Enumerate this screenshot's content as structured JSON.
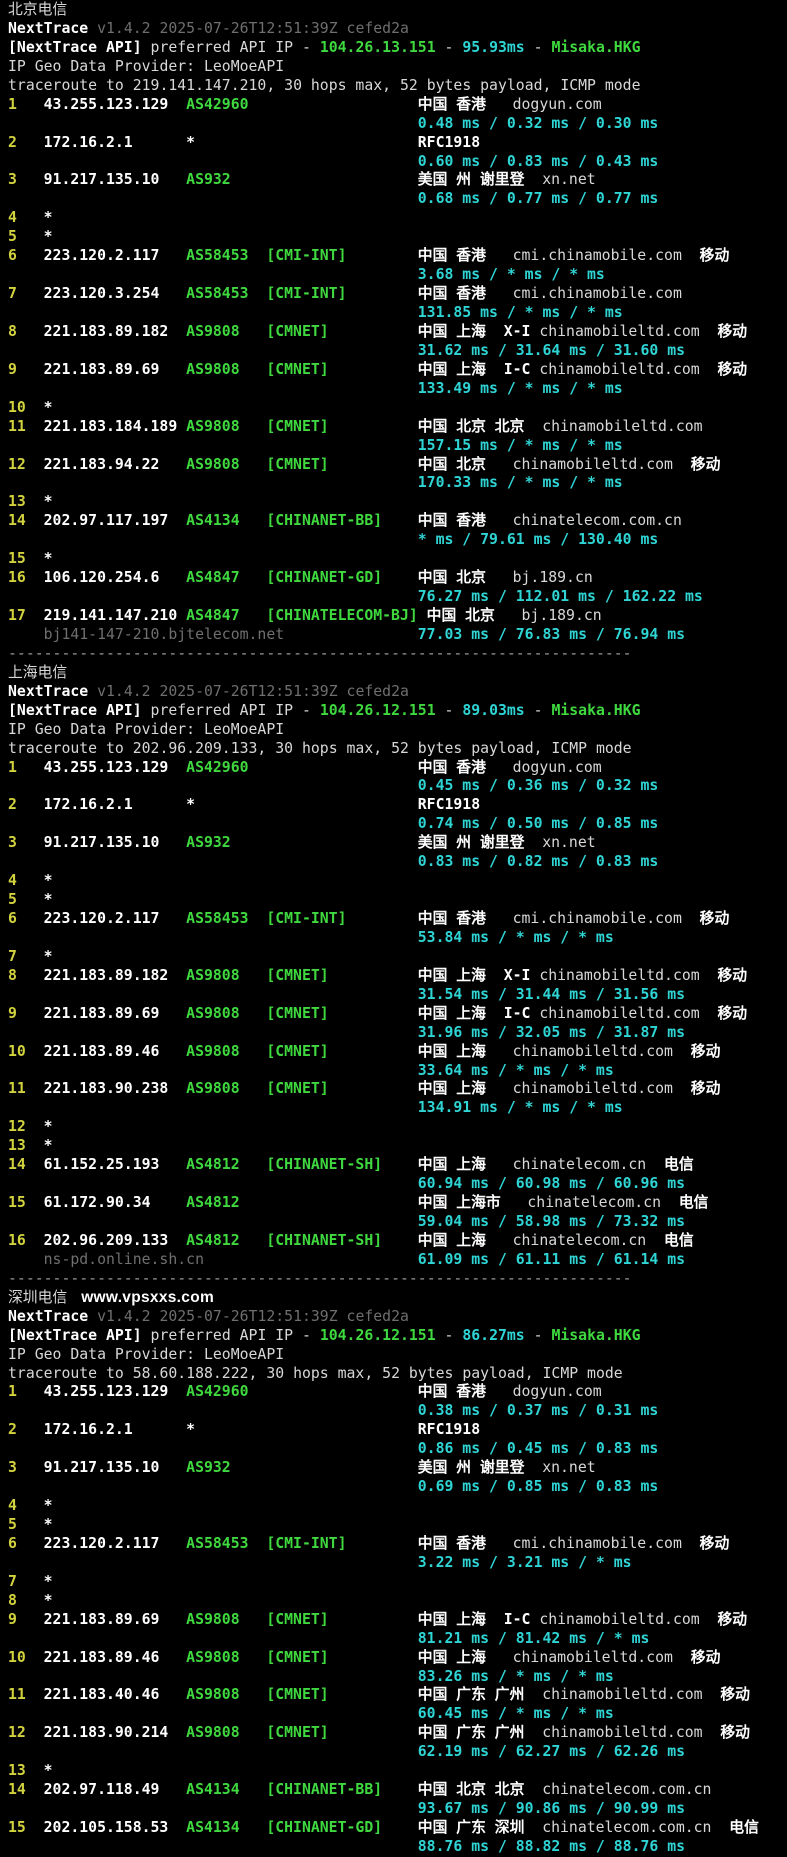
{
  "palette": {
    "bg": "#000000",
    "fg": "#d8d8d8",
    "bright": "#ffffff",
    "dim": "#6f6f6f",
    "yellow": "#d2d23e",
    "green": "#3fd93f",
    "cyan": "#2fd4d4",
    "sepc": "#9b9b9b"
  },
  "sections": [
    {
      "id": "beijing-telecom",
      "title": "北京电信",
      "watermark": "",
      "app": "NextTrace",
      "version": "v1.4.2 2025-07-26T12:51:39Z cefed2a",
      "api": {
        "label": "[NextTrace API]",
        "text": "preferred API IP",
        "ip": "104.26.13.151",
        "latency": "95.93ms",
        "node": "Misaka.HKG"
      },
      "geo": "IP Geo Data Provider: LeoMoeAPI",
      "trace": "traceroute to 219.141.147.210, 30 hops max, 52 bytes payload, ICMP mode",
      "separator": "----------------------------------------------------------------------",
      "hops": [
        {
          "num": "1",
          "ip": "43.255.123.129",
          "asn": "AS42960",
          "tag": "",
          "loc": "中国 香港   ",
          "domain": "dogyun.com",
          "rtt": "0.48 ms / 0.32 ms / 0.30 ms"
        },
        {
          "num": "2",
          "ip": "172.16.2.1",
          "asn": "*",
          "tag": "",
          "loc": "RFC1918",
          "rtt": "0.60 ms / 0.83 ms / 0.43 ms"
        },
        {
          "num": "3",
          "ip": "91.217.135.10",
          "asn": "AS932",
          "tag": "",
          "loc": "美国 州 谢里登  ",
          "domain": "xn.net",
          "rtt": "0.68 ms / 0.77 ms / 0.77 ms"
        },
        {
          "num": "4",
          "star": "*"
        },
        {
          "num": "5",
          "star": "*"
        },
        {
          "num": "6",
          "ip": "223.120.2.117",
          "asn": "AS58453",
          "tag": "[CMI-INT]",
          "loc": "中国 香港   ",
          "domain": "cmi.chinamobile.com",
          "carrier": "  移动",
          "rtt": "3.68 ms / * ms / * ms"
        },
        {
          "num": "7",
          "ip": "223.120.3.254",
          "asn": "AS58453",
          "tag": "[CMI-INT]",
          "loc": "中国 香港   ",
          "domain": "cmi.chinamobile.com",
          "rtt": "131.85 ms / * ms / * ms"
        },
        {
          "num": "8",
          "ip": "221.183.89.182",
          "asn": "AS9808",
          "tag": "[CMNET]",
          "loc": "中国 上海  ",
          "sub": "X-I ",
          "domain": "chinamobileltd.com",
          "carrier": "  移动",
          "rtt": "31.62 ms / 31.64 ms / 31.60 ms"
        },
        {
          "num": "9",
          "ip": "221.183.89.69",
          "asn": "AS9808",
          "tag": "[CMNET]",
          "loc": "中国 上海  ",
          "sub": "I-C ",
          "domain": "chinamobileltd.com",
          "carrier": "  移动",
          "rtt": "133.49 ms / * ms / * ms"
        },
        {
          "num": "10",
          "star": "*"
        },
        {
          "num": "11",
          "ip": "221.183.184.189",
          "asn": "AS9808",
          "tag": "[CMNET]",
          "loc": "中国 北京 北京  ",
          "domain": "chinamobileltd.com",
          "rtt": "157.15 ms / * ms / * ms"
        },
        {
          "num": "12",
          "ip": "221.183.94.22",
          "asn": "AS9808",
          "tag": "[CMNET]",
          "loc": "中国 北京   ",
          "domain": "chinamobileltd.com",
          "carrier": "  移动",
          "rtt": "170.33 ms / * ms / * ms"
        },
        {
          "num": "13",
          "star": "*"
        },
        {
          "num": "14",
          "ip": "202.97.117.197",
          "asn": "AS4134",
          "tag": "[CHINANET-BB]",
          "loc": "中国 香港   ",
          "domain": "chinatelecom.com.cn",
          "rtt": "* ms / 79.61 ms / 130.40 ms"
        },
        {
          "num": "15",
          "star": "*"
        },
        {
          "num": "16",
          "ip": "106.120.254.6",
          "asn": "AS4847",
          "tag": "[CHINANET-GD]",
          "loc": "中国 北京   ",
          "domain": "bj.189.cn",
          "rtt": "76.27 ms / 112.01 ms / 162.22 ms"
        },
        {
          "num": "17",
          "ip": "219.141.147.210",
          "asn": "AS4847",
          "tag": "[CHINATELECOM-BJ]",
          "loc": " 中国 北京   ",
          "domain": "bj.189.cn",
          "host": "bj141-147-210.bjtelecom.net",
          "rtt": "77.03 ms / 76.83 ms / 76.94 ms"
        }
      ]
    },
    {
      "id": "shanghai-telecom",
      "title": "上海电信",
      "watermark": "",
      "app": "NextTrace",
      "version": "v1.4.2 2025-07-26T12:51:39Z cefed2a",
      "api": {
        "label": "[NextTrace API]",
        "text": "preferred API IP",
        "ip": "104.26.12.151",
        "latency": "89.03ms",
        "node": "Misaka.HKG"
      },
      "geo": "IP Geo Data Provider: LeoMoeAPI",
      "trace": "traceroute to 202.96.209.133, 30 hops max, 52 bytes payload, ICMP mode",
      "separator": "----------------------------------------------------------------------",
      "hops": [
        {
          "num": "1",
          "ip": "43.255.123.129",
          "asn": "AS42960",
          "tag": "",
          "loc": "中国 香港   ",
          "domain": "dogyun.com",
          "rtt": "0.45 ms / 0.36 ms / 0.32 ms"
        },
        {
          "num": "2",
          "ip": "172.16.2.1",
          "asn": "*",
          "tag": "",
          "loc": "RFC1918",
          "rtt": "0.74 ms / 0.50 ms / 0.85 ms"
        },
        {
          "num": "3",
          "ip": "91.217.135.10",
          "asn": "AS932",
          "tag": "",
          "loc": "美国 州 谢里登  ",
          "domain": "xn.net",
          "rtt": "0.83 ms / 0.82 ms / 0.83 ms"
        },
        {
          "num": "4",
          "star": "*"
        },
        {
          "num": "5",
          "star": "*"
        },
        {
          "num": "6",
          "ip": "223.120.2.117",
          "asn": "AS58453",
          "tag": "[CMI-INT]",
          "loc": "中国 香港   ",
          "domain": "cmi.chinamobile.com",
          "carrier": "  移动",
          "rtt": "53.84 ms / * ms / * ms"
        },
        {
          "num": "7",
          "star": "*"
        },
        {
          "num": "8",
          "ip": "221.183.89.182",
          "asn": "AS9808",
          "tag": "[CMNET]",
          "loc": "中国 上海  ",
          "sub": "X-I ",
          "domain": "chinamobileltd.com",
          "carrier": "  移动",
          "rtt": "31.54 ms / 31.44 ms / 31.56 ms"
        },
        {
          "num": "9",
          "ip": "221.183.89.69",
          "asn": "AS9808",
          "tag": "[CMNET]",
          "loc": "中国 上海  ",
          "sub": "I-C ",
          "domain": "chinamobileltd.com",
          "carrier": "  移动",
          "rtt": "31.96 ms / 32.05 ms / 31.87 ms"
        },
        {
          "num": "10",
          "ip": "221.183.89.46",
          "asn": "AS9808",
          "tag": "[CMNET]",
          "loc": "中国 上海   ",
          "domain": "chinamobileltd.com",
          "carrier": "  移动",
          "rtt": "33.64 ms / * ms / * ms"
        },
        {
          "num": "11",
          "ip": "221.183.90.238",
          "asn": "AS9808",
          "tag": "[CMNET]",
          "loc": "中国 上海   ",
          "domain": "chinamobileltd.com",
          "carrier": "  移动",
          "rtt": "134.91 ms / * ms / * ms"
        },
        {
          "num": "12",
          "star": "*"
        },
        {
          "num": "13",
          "star": "*"
        },
        {
          "num": "14",
          "ip": "61.152.25.193",
          "asn": "AS4812",
          "tag": "[CHINANET-SH]",
          "loc": "中国 上海   ",
          "domain": "chinatelecom.cn",
          "carrier": "  电信",
          "rtt": "60.94 ms / 60.98 ms / 60.96 ms"
        },
        {
          "num": "15",
          "ip": "61.172.90.34",
          "asn": "AS4812",
          "tag": "",
          "loc": "中国 上海市   ",
          "domain": "chinatelecom.cn",
          "carrier": "  电信",
          "rtt": "59.04 ms / 58.98 ms / 73.32 ms"
        },
        {
          "num": "16",
          "ip": "202.96.209.133",
          "asn": "AS4812",
          "tag": "[CHINANET-SH]",
          "loc": "中国 上海   ",
          "domain": "chinatelecom.cn",
          "carrier": "  电信",
          "host": "ns-pd.online.sh.cn",
          "rtt": "61.09 ms / 61.11 ms / 61.14 ms"
        }
      ]
    },
    {
      "id": "shenzhen-telecom",
      "title": "深圳电信",
      "watermark": "www.vpsxxs.com",
      "app": "NextTrace",
      "version": "v1.4.2 2025-07-26T12:51:39Z cefed2a",
      "api": {
        "label": "[NextTrace API]",
        "text": "preferred API IP",
        "ip": "104.26.12.151",
        "latency": "86.27ms",
        "node": "Misaka.HKG"
      },
      "geo": "IP Geo Data Provider: LeoMoeAPI",
      "trace": "traceroute to 58.60.188.222, 30 hops max, 52 bytes payload, ICMP mode",
      "separator": "",
      "hops": [
        {
          "num": "1",
          "ip": "43.255.123.129",
          "asn": "AS42960",
          "tag": "",
          "loc": "中国 香港   ",
          "domain": "dogyun.com",
          "rtt": "0.38 ms / 0.37 ms / 0.31 ms"
        },
        {
          "num": "2",
          "ip": "172.16.2.1",
          "asn": "*",
          "tag": "",
          "loc": "RFC1918",
          "rtt": "0.86 ms / 0.45 ms / 0.83 ms"
        },
        {
          "num": "3",
          "ip": "91.217.135.10",
          "asn": "AS932",
          "tag": "",
          "loc": "美国 州 谢里登  ",
          "domain": "xn.net",
          "rtt": "0.69 ms / 0.85 ms / 0.83 ms"
        },
        {
          "num": "4",
          "star": "*"
        },
        {
          "num": "5",
          "star": "*"
        },
        {
          "num": "6",
          "ip": "223.120.2.117",
          "asn": "AS58453",
          "tag": "[CMI-INT]",
          "loc": "中国 香港   ",
          "domain": "cmi.chinamobile.com",
          "carrier": "  移动",
          "rtt": "3.22 ms / 3.21 ms / * ms"
        },
        {
          "num": "7",
          "star": "*"
        },
        {
          "num": "8",
          "star": "*"
        },
        {
          "num": "9",
          "ip": "221.183.89.69",
          "asn": "AS9808",
          "tag": "[CMNET]",
          "loc": "中国 上海  ",
          "sub": "I-C ",
          "domain": "chinamobileltd.com",
          "carrier": "  移动",
          "rtt": "81.21 ms / 81.42 ms / * ms"
        },
        {
          "num": "10",
          "ip": "221.183.89.46",
          "asn": "AS9808",
          "tag": "[CMNET]",
          "loc": "中国 上海   ",
          "domain": "chinamobileltd.com",
          "carrier": "  移动",
          "rtt": "83.26 ms / * ms / * ms"
        },
        {
          "num": "11",
          "ip": "221.183.40.46",
          "asn": "AS9808",
          "tag": "[CMNET]",
          "loc": "中国 广东 广州  ",
          "domain": "chinamobileltd.com",
          "carrier": "  移动",
          "rtt": "60.45 ms / * ms / * ms"
        },
        {
          "num": "12",
          "ip": "221.183.90.214",
          "asn": "AS9808",
          "tag": "[CMNET]",
          "loc": "中国 广东 广州  ",
          "domain": "chinamobileltd.com",
          "carrier": "  移动",
          "rtt": "62.19 ms / 62.27 ms / 62.26 ms"
        },
        {
          "num": "13",
          "star": "*"
        },
        {
          "num": "14",
          "ip": "202.97.118.49",
          "asn": "AS4134",
          "tag": "[CHINANET-BB]",
          "loc": "中国 北京 北京  ",
          "domain": "chinatelecom.com.cn",
          "rtt": "93.67 ms / 90.86 ms / 90.99 ms"
        },
        {
          "num": "15",
          "ip": "202.105.158.53",
          "asn": "AS4134",
          "tag": "[CHINANET-GD]",
          "loc": "中国 广东 深圳  ",
          "domain": "chinatelecom.com.cn",
          "carrier": "  电信",
          "rtt": "88.76 ms / 88.82 ms / 88.76 ms"
        }
      ]
    }
  ]
}
